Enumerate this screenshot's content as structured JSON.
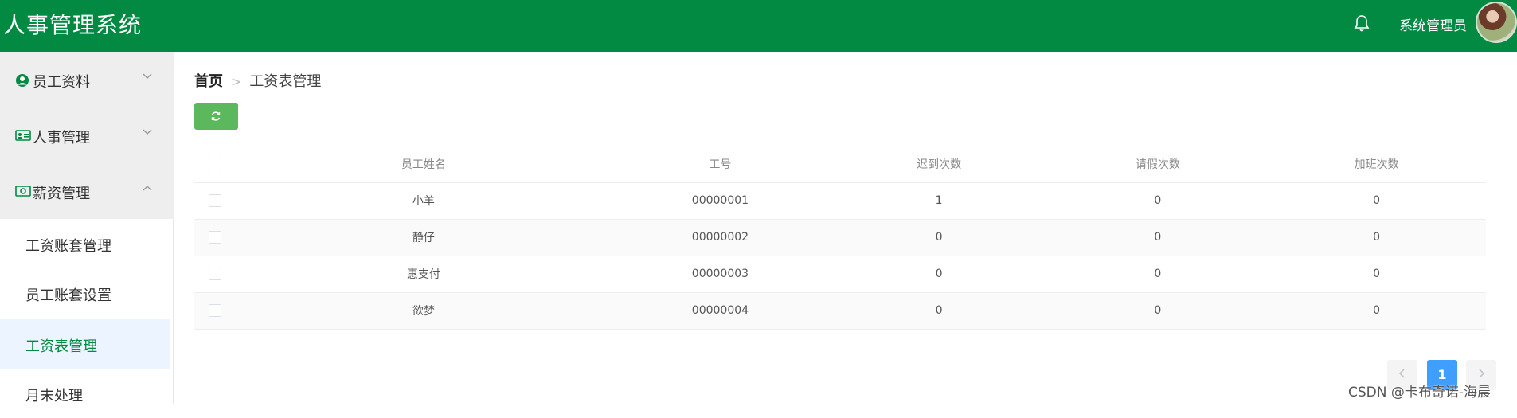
{
  "header": {
    "app_title": "人事管理系统",
    "user_name": "系统管理员"
  },
  "sidebar": {
    "groups": [
      {
        "label": "员工资料",
        "icon": "user-circle-icon",
        "expanded": false
      },
      {
        "label": "人事管理",
        "icon": "id-card-icon",
        "expanded": false
      },
      {
        "label": "薪资管理",
        "icon": "money-icon",
        "expanded": true
      }
    ],
    "sub_items": [
      {
        "label": "工资账套管理"
      },
      {
        "label": "员工账套设置"
      },
      {
        "label": "工资表管理",
        "active": true
      },
      {
        "label": "月末处理"
      }
    ]
  },
  "breadcrumb": {
    "home": "首页",
    "current": "工资表管理"
  },
  "toolbar": {
    "refresh_icon": "refresh-icon"
  },
  "table": {
    "columns": [
      "员工姓名",
      "工号",
      "迟到次数",
      "请假次数",
      "加班次数"
    ],
    "rows": [
      [
        "小羊",
        "00000001",
        "1",
        "0",
        "0"
      ],
      [
        "静仔",
        "00000002",
        "0",
        "0",
        "0"
      ],
      [
        "惠支付",
        "00000003",
        "0",
        "0",
        "0"
      ],
      [
        "欲梦",
        "00000004",
        "0",
        "0",
        "0"
      ]
    ]
  },
  "pagination": {
    "current_page": "1",
    "prev_icon": "chevron-left-icon",
    "next_icon": "chevron-right-icon"
  },
  "watermark": "CSDN @卡布奇诺-海晨",
  "colors": {
    "header_bg": "#028a43",
    "refresh_button": "#5cb85c",
    "active_page": "#409eff",
    "active_menu_text": "#028a43"
  }
}
